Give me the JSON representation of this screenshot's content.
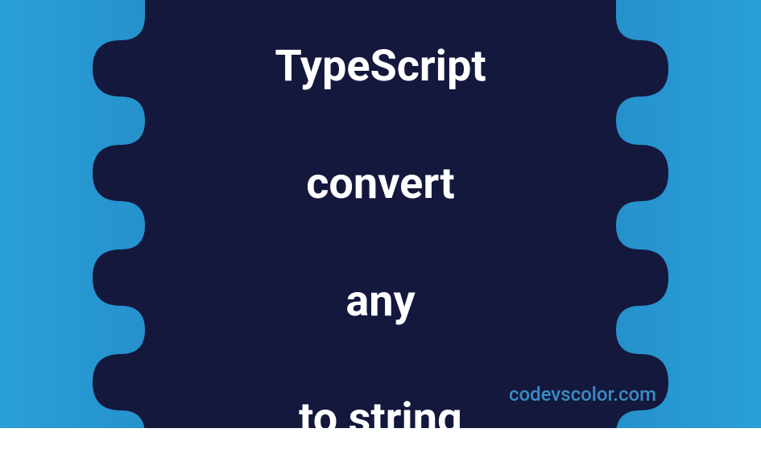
{
  "title": {
    "line1": "TypeScript",
    "line2": "convert",
    "line3": "any",
    "line4": "to string"
  },
  "attribution": "codevscolor.com",
  "colors": {
    "gradient_left": "#2a9fd8",
    "gradient_right": "#2a9fd8",
    "blob": "#14183d",
    "text": "#ffffff",
    "attribution_text": "#3a8cc4"
  }
}
